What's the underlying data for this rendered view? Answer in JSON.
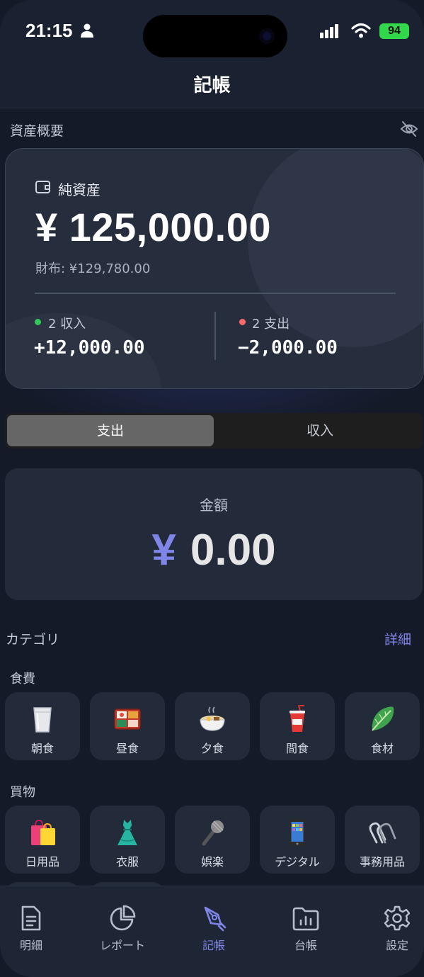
{
  "status_bar": {
    "time": "21:15",
    "battery": "94"
  },
  "nav": {
    "title": "記帳"
  },
  "overview": {
    "section_title": "資産概要",
    "net_assets_label": "純資産",
    "net_assets_amount": "¥ 125,000.00",
    "wallet_text": "財布: ¥129,780.00",
    "income_label": "2 収入",
    "income_value": "+12,000.00",
    "expense_label": "2 支出",
    "expense_value": "−2,000.00"
  },
  "segment": {
    "expense": "支出",
    "income": "収入",
    "selected": "expense"
  },
  "amount": {
    "label": "金額",
    "currency": "¥",
    "value": "0.00"
  },
  "category": {
    "title": "カテゴリ",
    "detail_link": "詳細",
    "groups": [
      {
        "title": "食費",
        "items": [
          {
            "label": "朝食",
            "icon": "milk-glass-icon"
          },
          {
            "label": "昼食",
            "icon": "bento-box-icon"
          },
          {
            "label": "夕食",
            "icon": "ramen-bowl-icon"
          },
          {
            "label": "間食",
            "icon": "drink-cup-icon"
          },
          {
            "label": "食材",
            "icon": "leafy-green-icon"
          }
        ]
      },
      {
        "title": "買物",
        "items": [
          {
            "label": "日用品",
            "icon": "shopping-bags-icon"
          },
          {
            "label": "衣服",
            "icon": "dress-icon"
          },
          {
            "label": "娯楽",
            "icon": "microphone-icon"
          },
          {
            "label": "デジタル",
            "icon": "smartphone-icon"
          },
          {
            "label": "事務用品",
            "icon": "paperclip-icon"
          }
        ]
      }
    ]
  },
  "tabbar": [
    {
      "label": "明細",
      "icon": "document-icon",
      "active": false
    },
    {
      "label": "レポート",
      "icon": "pie-chart-icon",
      "active": false
    },
    {
      "label": "記帳",
      "icon": "pen-icon",
      "active": true
    },
    {
      "label": "台帳",
      "icon": "folder-chart-icon",
      "active": false
    },
    {
      "label": "設定",
      "icon": "gear-icon",
      "active": false
    }
  ],
  "colors": {
    "accent": "#8086e8",
    "income_dot": "#34c759",
    "expense_dot": "#ff6b6b",
    "battery": "#32d74b"
  }
}
